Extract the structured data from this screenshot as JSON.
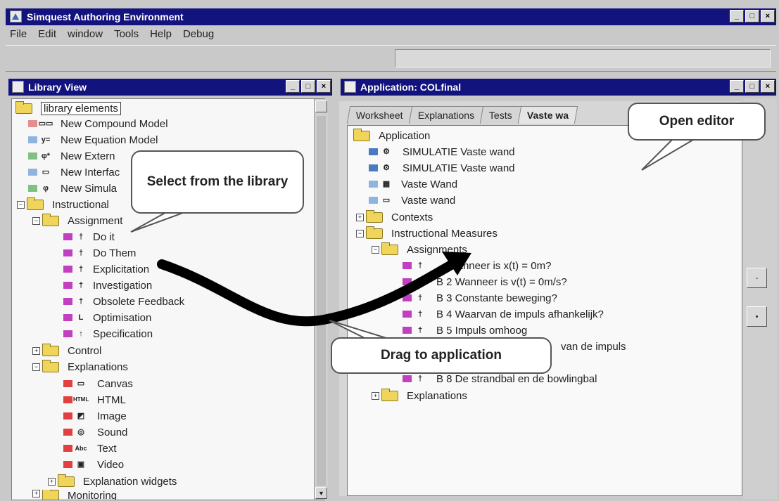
{
  "window": {
    "title": "Simquest Authoring Environment"
  },
  "menu": [
    "File",
    "Edit",
    "window",
    "Tools",
    "Help",
    "Debug"
  ],
  "library": {
    "title": "Library View",
    "root": "library elements",
    "items": [
      {
        "label": "New Compound Model",
        "icon": "compound-model-icon",
        "color": "#e09090"
      },
      {
        "label": "New Equation Model",
        "icon": "equation-model-icon",
        "color": "#8fb4e0"
      },
      {
        "label": "New Extern",
        "icon": "external-model-icon",
        "color": "#80c080"
      },
      {
        "label": "New Interfac",
        "icon": "interface-icon",
        "color": "#8fb4e0"
      },
      {
        "label": "New Simula",
        "icon": "simulation-icon",
        "color": "#80c080"
      },
      {
        "label": "Instructional",
        "icon": "folder-icon"
      },
      {
        "label": "Assignment",
        "icon": "folder-icon"
      },
      {
        "label": "Do it",
        "icon": "assignment-icon",
        "color": "#c040c0"
      },
      {
        "label": "Do Them",
        "icon": "assignment-icon",
        "color": "#c040c0"
      },
      {
        "label": "Explicitation",
        "icon": "assignment-icon",
        "color": "#c040c0"
      },
      {
        "label": "Investigation",
        "icon": "assignment-icon",
        "color": "#c040c0"
      },
      {
        "label": "Obsolete Feedback",
        "icon": "assignment-icon",
        "color": "#c040c0"
      },
      {
        "label": "Optimisation",
        "icon": "assignment-icon",
        "color": "#c040c0"
      },
      {
        "label": "Specification",
        "icon": "assignment-icon",
        "color": "#c040c0"
      },
      {
        "label": "Control",
        "icon": "folder-icon"
      },
      {
        "label": "Explanations",
        "icon": "folder-icon"
      },
      {
        "label": "Canvas",
        "icon": "canvas-icon",
        "color": "#e04040"
      },
      {
        "label": "HTML",
        "icon": "html-icon",
        "color": "#e04040"
      },
      {
        "label": "Image",
        "icon": "image-icon",
        "color": "#e04040"
      },
      {
        "label": "Sound",
        "icon": "sound-icon",
        "color": "#e04040"
      },
      {
        "label": "Text",
        "icon": "text-icon",
        "color": "#e04040"
      },
      {
        "label": "Video",
        "icon": "video-icon",
        "color": "#e04040"
      },
      {
        "label": "Explanation widgets",
        "icon": "folder-icon"
      },
      {
        "label": "Monitoring",
        "icon": "folder-icon"
      }
    ]
  },
  "application": {
    "title": "Application: COLfinal",
    "tabs": [
      "Worksheet",
      "Explanations",
      "Tests",
      "Vaste wa"
    ],
    "root": "Application",
    "items": [
      {
        "label": "SIMULATIE Vaste wand"
      },
      {
        "label": "SIMULATIE Vaste wand"
      },
      {
        "label": "Vaste Wand"
      },
      {
        "label": "Vaste wand"
      },
      {
        "label": "Contexts"
      },
      {
        "label": "Instructional Measures"
      },
      {
        "label": "Assignments"
      },
      {
        "label": "Wanneer is x(t) = 0m?"
      },
      {
        "label": "B 2 Wanneer is v(t) = 0m/s?"
      },
      {
        "label": "B 3 Constante beweging?"
      },
      {
        "label": "B 4 Waarvan de impuls afhankelijk?"
      },
      {
        "label": "B 5 Impuls omhoog"
      },
      {
        "label": "van de impuls"
      },
      {
        "label": "B 8 De strandbal en de bowlingbal"
      },
      {
        "label": "Explanations"
      }
    ]
  },
  "callouts": {
    "select": "Select from the library",
    "open": "Open editor",
    "drag": "Drag to application"
  },
  "side_buttons": [
    "-",
    "•"
  ],
  "win_buttons": [
    "_",
    "□",
    "×"
  ]
}
